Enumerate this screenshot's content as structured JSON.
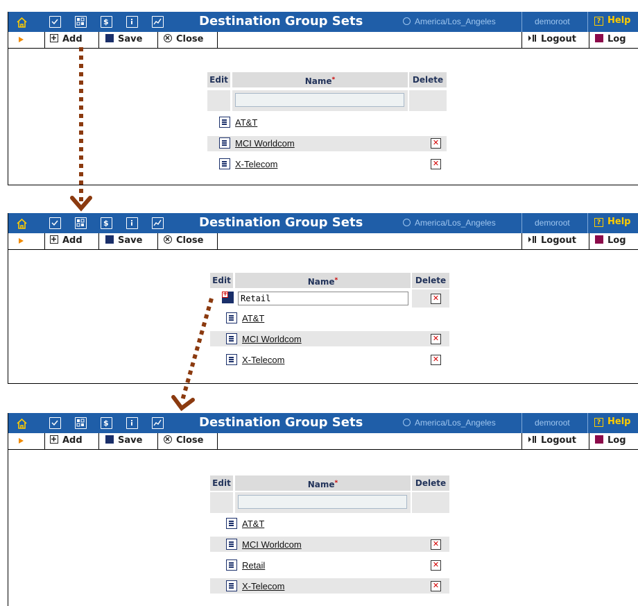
{
  "header": {
    "title": "Destination Group Sets",
    "timezone": "America/Los_Angeles",
    "user": "demoroot",
    "help_label": "Help"
  },
  "toolbar": {
    "add_label": "Add",
    "save_label": "Save",
    "close_label": "Close",
    "logout_label": "Logout",
    "log_label": "Log"
  },
  "table": {
    "col_edit": "Edit",
    "col_name": "Name",
    "required_mark": "*",
    "col_delete": "Delete"
  },
  "panel1": {
    "rows": [
      {
        "name": "AT&T",
        "deletable": false
      },
      {
        "name": "MCI Worldcom",
        "deletable": true
      },
      {
        "name": "X-Telecom",
        "deletable": true
      }
    ]
  },
  "panel2": {
    "new_value": "Retail",
    "rows": [
      {
        "name": "AT&T",
        "deletable": false
      },
      {
        "name": "MCI Worldcom",
        "deletable": true
      },
      {
        "name": "X-Telecom",
        "deletable": true
      }
    ]
  },
  "panel3": {
    "rows": [
      {
        "name": "AT&T",
        "deletable": false
      },
      {
        "name": "MCI Worldcom",
        "deletable": true
      },
      {
        "name": "Retail",
        "deletable": true
      },
      {
        "name": "X-Telecom",
        "deletable": true
      }
    ]
  },
  "colors": {
    "header_bg": "#1f5ea8",
    "help": "#ffcc00",
    "annotation_arrow": "#8b3a0f",
    "delete_x": "#d40000"
  },
  "icons": [
    "home-icon",
    "checkbox-icon",
    "grid-icon",
    "dollar-icon",
    "info-icon",
    "chart-icon",
    "clock-icon",
    "help-icon",
    "add-icon",
    "save-icon",
    "close-icon",
    "logout-icon",
    "log-icon",
    "edit-icon",
    "delete-icon",
    "save-new-icon"
  ]
}
